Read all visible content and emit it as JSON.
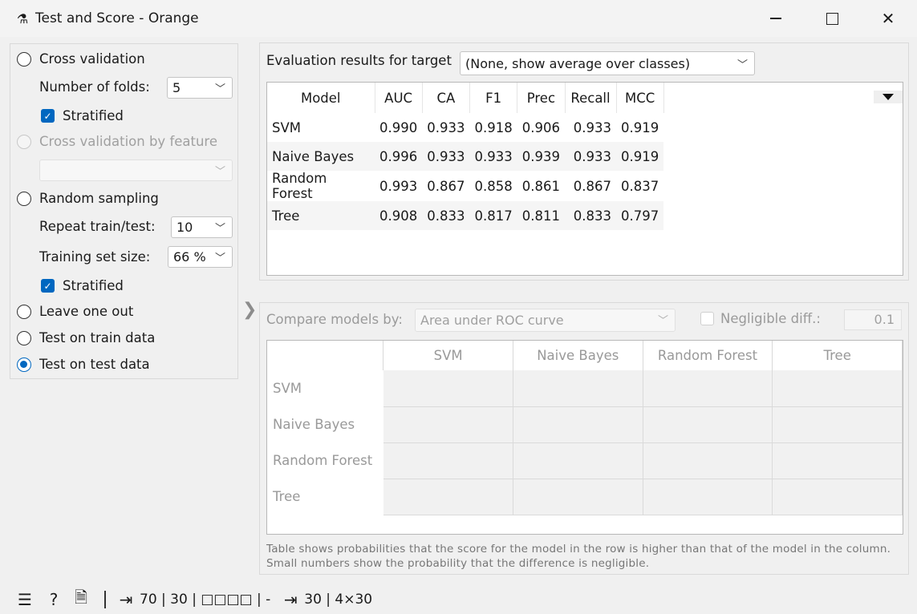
{
  "window": {
    "title": "Test and Score - Orange"
  },
  "sampling": {
    "cross_validation": "Cross validation",
    "folds_label": "Number of folds:",
    "folds_value": "5",
    "stratified1": "Stratified",
    "cv_by_feature": "Cross validation by feature",
    "random_sampling": "Random sampling",
    "repeat_label": "Repeat train/test:",
    "repeat_value": "10",
    "train_size_label": "Training set size:",
    "train_size_value": "66 %",
    "stratified2": "Stratified",
    "leave_one_out": "Leave one out",
    "test_on_train": "Test on train data",
    "test_on_test": "Test on test data"
  },
  "evaluation": {
    "label": "Evaluation results for target",
    "target": "(None, show average over classes)",
    "columns": [
      "Model",
      "AUC",
      "CA",
      "F1",
      "Prec",
      "Recall",
      "MCC"
    ],
    "rows": [
      [
        "SVM",
        "0.990",
        "0.933",
        "0.918",
        "0.906",
        "0.933",
        "0.919"
      ],
      [
        "Naive Bayes",
        "0.996",
        "0.933",
        "0.933",
        "0.939",
        "0.933",
        "0.919"
      ],
      [
        "Random Forest",
        "0.993",
        "0.867",
        "0.858",
        "0.861",
        "0.867",
        "0.837"
      ],
      [
        "Tree",
        "0.908",
        "0.833",
        "0.817",
        "0.811",
        "0.833",
        "0.797"
      ]
    ]
  },
  "compare": {
    "label": "Compare models by:",
    "metric": "Area under ROC curve",
    "negligible_label": "Negligible diff.:",
    "negligible_value": "0.1",
    "models": [
      "SVM",
      "Naive Bayes",
      "Random Forest",
      "Tree"
    ],
    "note_line1": "Table shows probabilities that the score for the model in the row is higher than that of the model in the column.",
    "note_line2": "Small numbers show the probability that the difference is negligible."
  },
  "statusbar": {
    "input_summary": "70 | 30 | □□□□ | -",
    "output_summary": "30 | 4×30"
  }
}
